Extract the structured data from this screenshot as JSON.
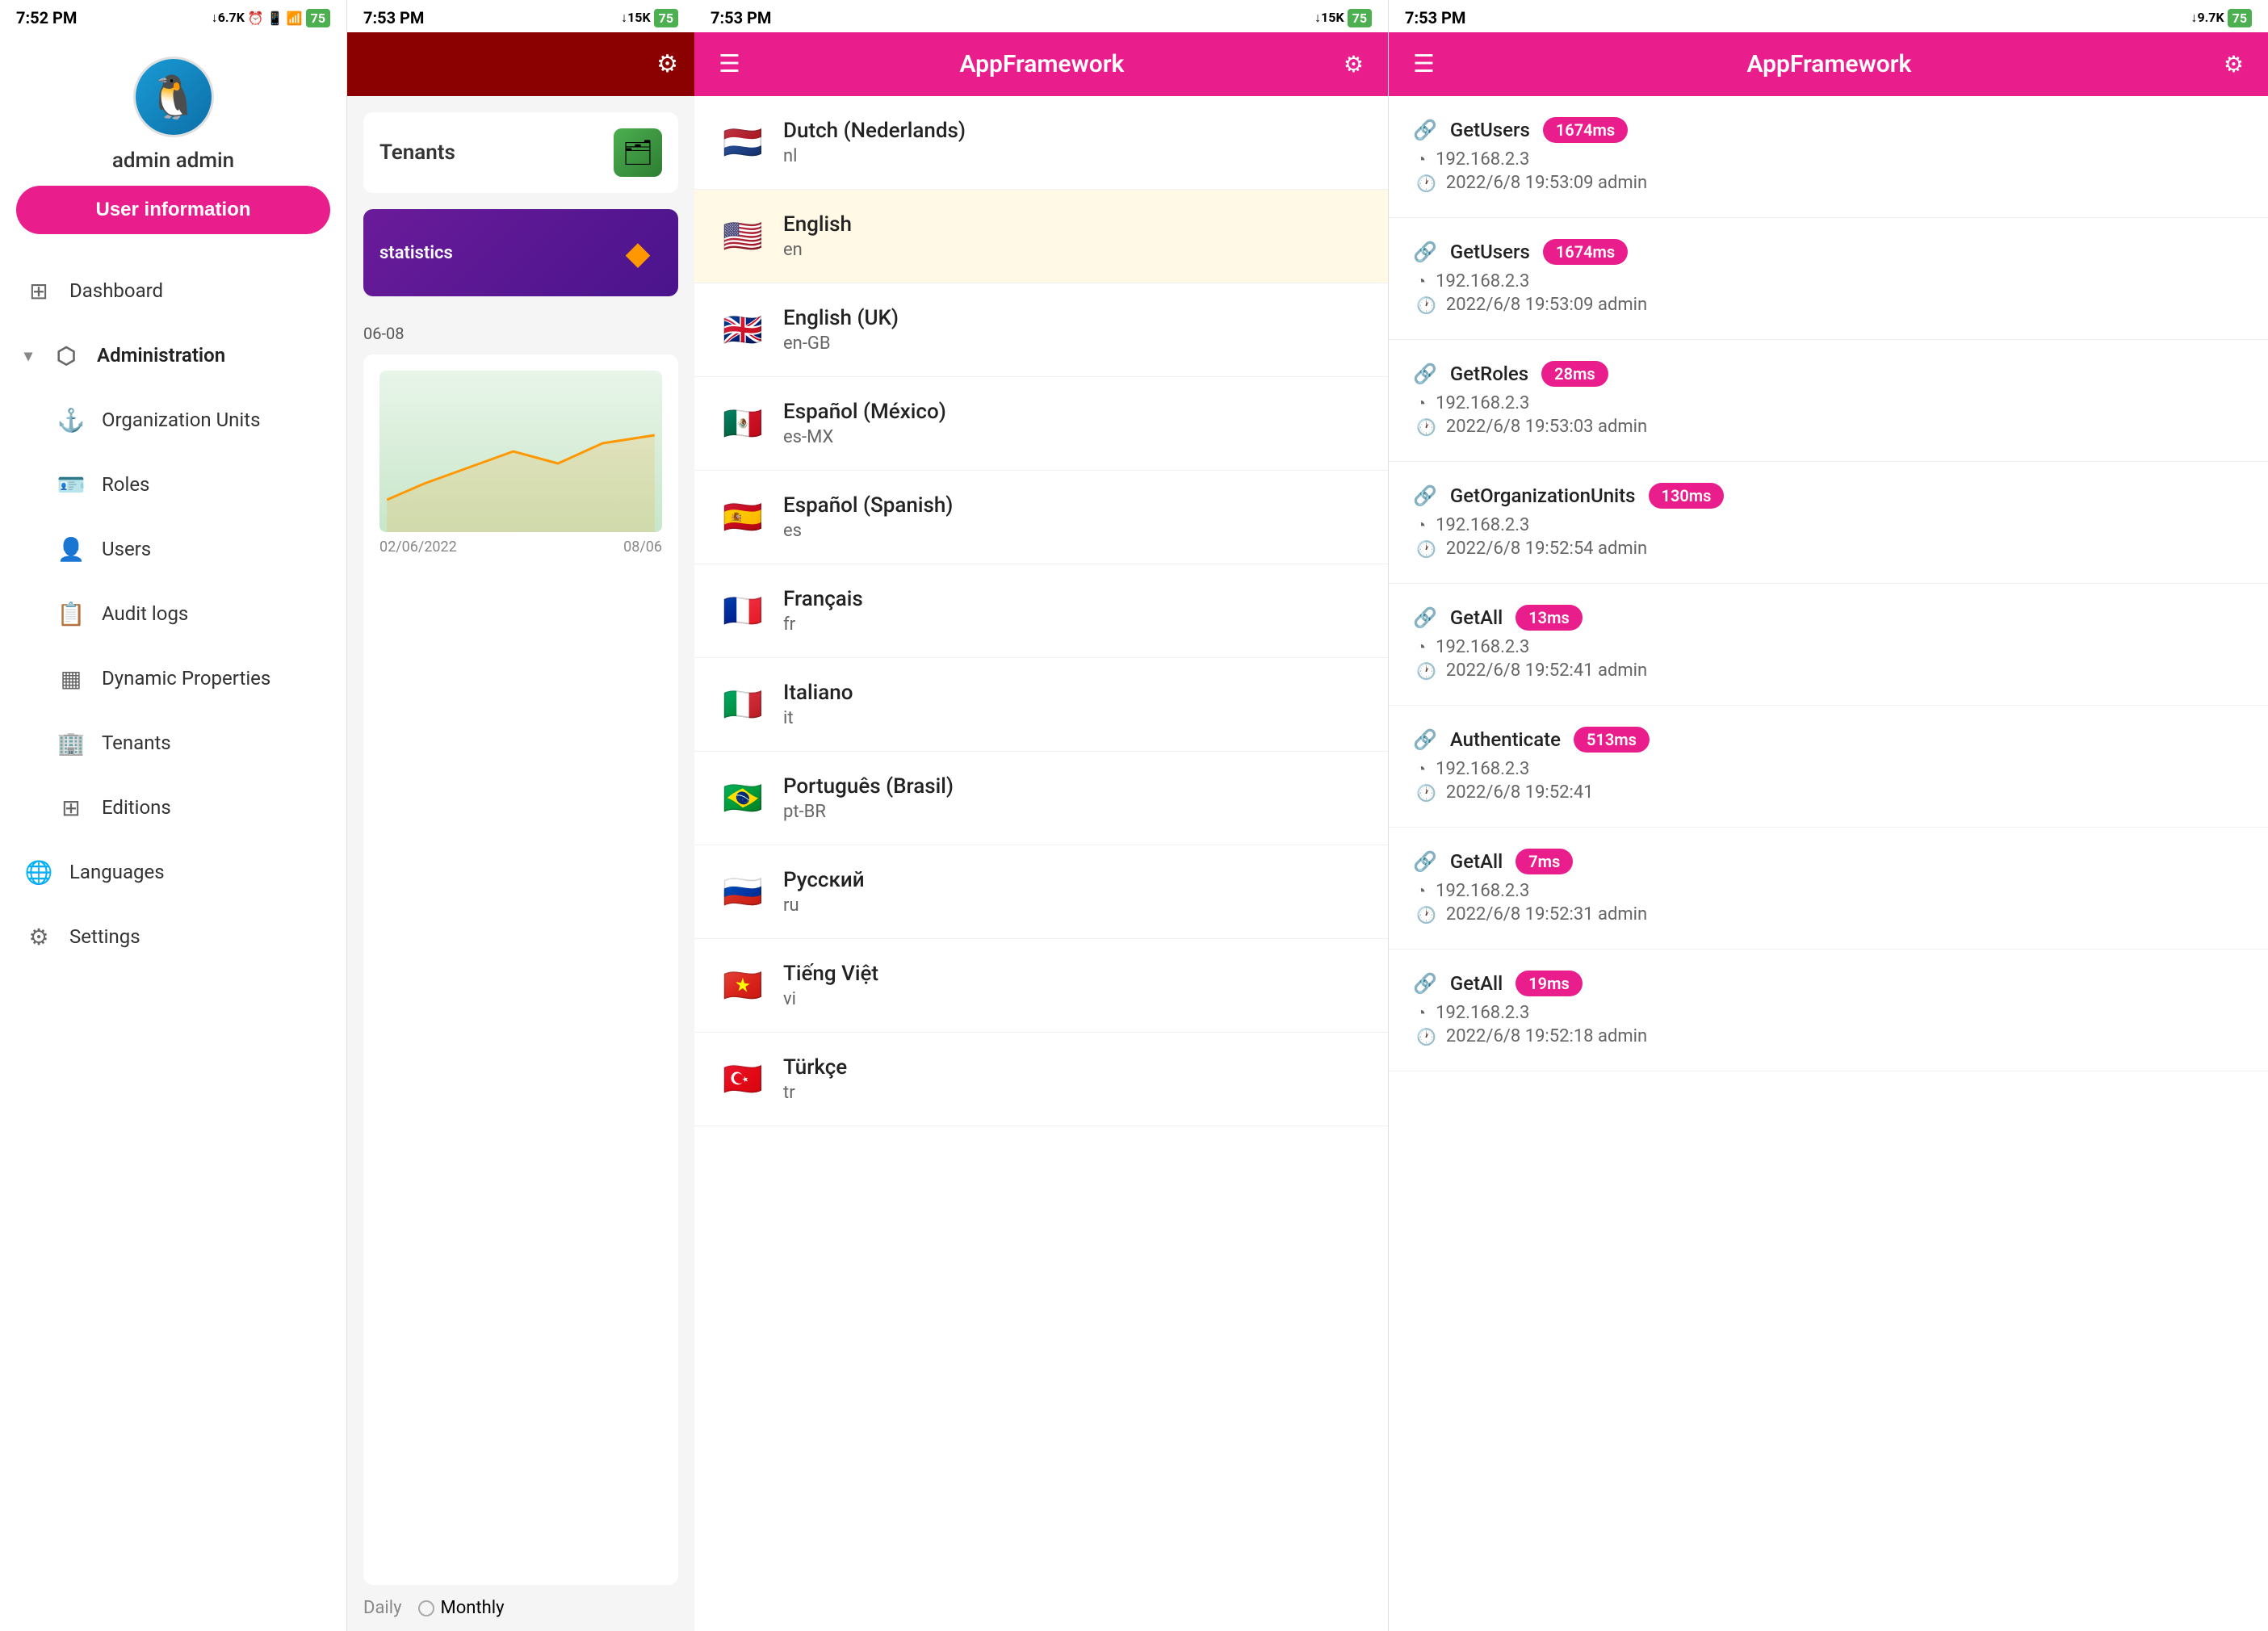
{
  "panels": {
    "panel1": {
      "status_bar": {
        "time": "7:52 PM",
        "network": "↓6.7K",
        "battery": "75"
      },
      "profile": {
        "name": "admin admin",
        "avatar_emoji": "🐧"
      },
      "user_info_button": "User information",
      "nav": {
        "dashboard": "Dashboard",
        "administration": "Administration",
        "organization_units": "Organization Units",
        "roles": "Roles",
        "users": "Users",
        "audit_logs": "Audit logs",
        "dynamic_properties": "Dynamic Properties",
        "tenants": "Tenants",
        "editions": "Editions",
        "languages": "Languages",
        "settings": "Settings"
      }
    },
    "panel2": {
      "status_bar": {
        "time": "7:53 PM",
        "network": "↓15K",
        "battery": "75"
      },
      "card1": {
        "title": "Tenants"
      },
      "card2": {
        "title": "statistics"
      },
      "date_label": "06-08",
      "chart_dates": [
        "02/06/2022",
        "08/06"
      ]
    },
    "panel3": {
      "status_bar": {
        "time": "7:53 PM",
        "network": "↓15K",
        "battery": "75"
      },
      "header": {
        "title": "AppFramework"
      },
      "languages": [
        {
          "flag": "🇳🇱",
          "name": "Dutch (Nederlands)",
          "code": "nl"
        },
        {
          "flag": "🇺🇸",
          "name": "English",
          "code": "en",
          "highlight": true
        },
        {
          "flag": "🇬🇧",
          "name": "English (UK)",
          "code": "en-GB"
        },
        {
          "flag": "🇲🇽",
          "name": "Español (México)",
          "code": "es-MX"
        },
        {
          "flag": "🇪🇸",
          "name": "Español (Spanish)",
          "code": "es"
        },
        {
          "flag": "🇫🇷",
          "name": "Français",
          "code": "fr"
        },
        {
          "flag": "🇮🇹",
          "name": "Italiano",
          "code": "it"
        },
        {
          "flag": "🇧🇷",
          "name": "Português (Brasil)",
          "code": "pt-BR"
        },
        {
          "flag": "🇷🇺",
          "name": "Русский",
          "code": "ru"
        },
        {
          "flag": "🇻🇳",
          "name": "Tiếng Việt",
          "code": "vi"
        },
        {
          "flag": "🇹🇷",
          "name": "Türkçe",
          "code": "tr"
        }
      ]
    },
    "panel4": {
      "status_bar": {
        "time": "7:53 PM",
        "network": "↓9.7K",
        "battery": "75"
      },
      "header": {
        "title": "AppFramework"
      },
      "logs": [
        {
          "method": "GetUsers",
          "badge": "1674ms",
          "ip": "192.168.2.3",
          "timestamp": "2022/6/8 19:53:09 admin"
        },
        {
          "method": "GetUsers",
          "badge": "1674ms",
          "ip": "192.168.2.3",
          "timestamp": "2022/6/8 19:53:09 admin"
        },
        {
          "method": "GetRoles",
          "badge": "28ms",
          "ip": "192.168.2.3",
          "timestamp": "2022/6/8 19:53:03 admin"
        },
        {
          "method": "GetOrganizationUnits",
          "badge": "130ms",
          "ip": "192.168.2.3",
          "timestamp": "2022/6/8 19:52:54 admin"
        },
        {
          "method": "GetAll",
          "badge": "13ms",
          "ip": "192.168.2.3",
          "timestamp": "2022/6/8 19:52:41 admin"
        },
        {
          "method": "Authenticate",
          "badge": "513ms",
          "ip": "192.168.2.3",
          "timestamp": "2022/6/8 19:52:41"
        },
        {
          "method": "GetAll",
          "badge": "7ms",
          "ip": "192.168.2.3",
          "timestamp": "2022/6/8 19:52:31 admin"
        },
        {
          "method": "GetAll",
          "badge": "19ms",
          "ip": "192.168.2.3",
          "timestamp": "2022/6/8 19:52:18 admin"
        }
      ]
    }
  },
  "colors": {
    "accent": "#e91e8c",
    "dark_red": "#8B0000",
    "purple": "#6a1b9a",
    "green": "#4caf50"
  }
}
